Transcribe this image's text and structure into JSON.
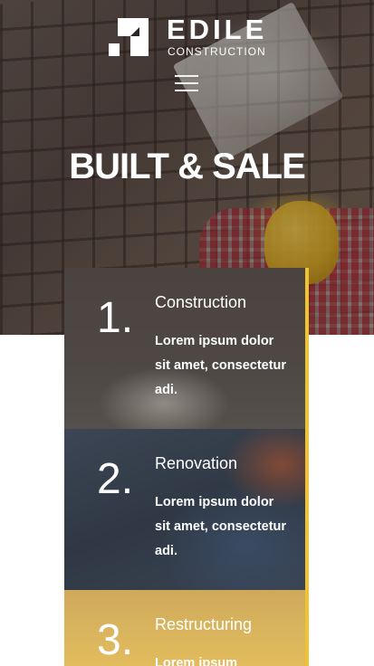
{
  "brand": {
    "name": "EDILE",
    "tagline": "CONSTRUCTION"
  },
  "header": {
    "menu_icon": "hamburger-menu-icon"
  },
  "hero": {
    "title": "BUILT & SALE"
  },
  "cards": [
    {
      "number": "1.",
      "title": "Construction",
      "text": "Lorem ipsum dolor sit amet, consectetur adi."
    },
    {
      "number": "2.",
      "title": "Renovation",
      "text": "Lorem ipsum dolor sit amet, consectetur adi."
    },
    {
      "number": "3.",
      "title": "Restructuring",
      "text": "Lorem ipsum"
    }
  ],
  "colors": {
    "accent": "#f1c232",
    "text": "#ffffff"
  }
}
